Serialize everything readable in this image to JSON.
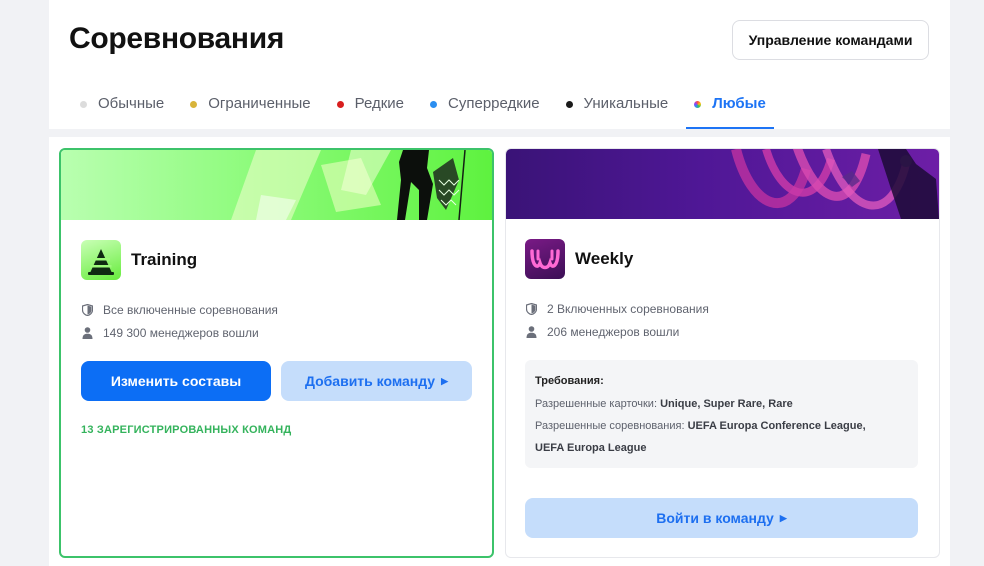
{
  "header": {
    "title": "Соревнования",
    "manage_button": "Управление командами"
  },
  "tabs": [
    {
      "label": "Обычные",
      "color": "#dcdcdc"
    },
    {
      "label": "Ограниченные",
      "color": "#d8b43a"
    },
    {
      "label": "Редкие",
      "color": "#d81e1e"
    },
    {
      "label": "Суперредкие",
      "color": "#2b8ef0"
    },
    {
      "label": "Уникальные",
      "color": "#1a1a1a"
    },
    {
      "label": "Любые",
      "color": "rainbow",
      "active": true
    }
  ],
  "cards": [
    {
      "name": "Training",
      "competitions": "Все включенные соревнования",
      "managers": "149 300 менеджеров вошли",
      "edit_button": "Изменить составы",
      "add_button": "Добавить команду",
      "registered": "13 ЗАРЕГИСТРИРОВАННЫХ КОМАНД",
      "accent": "#3cc36a"
    },
    {
      "name": "Weekly",
      "competitions": "2 Включенных соревнования",
      "managers": "206 менеджеров вошли",
      "requirements": {
        "title": "Требования:",
        "cards_label": "Разрешенные карточки: ",
        "cards_value": "Unique, Super Rare, Rare",
        "competitions_label": "Разрешенные соревнования: ",
        "competitions_value_1": "UEFA Europa Conference League,",
        "competitions_value_2": "UEFA Europa League"
      },
      "join_button": "Войти в команду",
      "accent": "#4f1796"
    }
  ],
  "icons": {
    "shield": "shield-icon",
    "user": "user-icon",
    "caret": "caret-right-icon"
  },
  "colors": {
    "primary": "#0c6ef5",
    "soft_button": "#c5ddfb",
    "active_tab": "#1d74f5",
    "success": "#34b35c"
  }
}
